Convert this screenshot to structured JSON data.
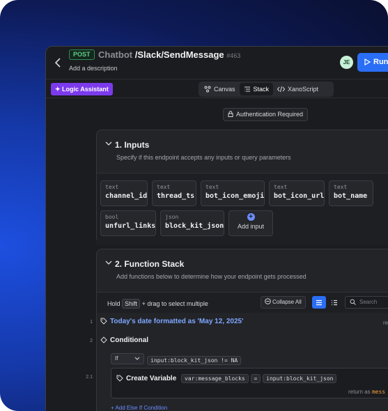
{
  "header": {
    "method": "POST",
    "crumb": "Chatbot",
    "path": "/Slack/SendMessage",
    "id": "#463",
    "description": "Add a description",
    "avatar": "JE",
    "run_label": "Run"
  },
  "toolbar": {
    "logic_assistant": "Logic Assistant",
    "tabs": [
      {
        "label": "Canvas",
        "icon": "canvas-icon"
      },
      {
        "label": "Stack",
        "icon": "stack-icon",
        "active": true
      },
      {
        "label": "XanoScript",
        "icon": "code-icon"
      }
    ]
  },
  "auth_chip": "Authentication Required",
  "inputs": {
    "title": "1. Inputs",
    "subtitle": "Specify if this endpoint accepts any inputs or query parameters",
    "items": [
      {
        "type": "text",
        "name": "channel_id"
      },
      {
        "type": "text",
        "name": "thread_ts"
      },
      {
        "type": "text",
        "name": "bot_icon_emoji"
      },
      {
        "type": "text",
        "name": "bot_icon_url"
      },
      {
        "type": "text",
        "name": "bot_name"
      },
      {
        "type": "bool",
        "name": "unfurl_links"
      },
      {
        "type": "json",
        "name": "block_kit_json"
      }
    ],
    "add_label": "Add input"
  },
  "stack": {
    "title": "2. Function Stack",
    "subtitle": "Add functions below to determine how your endpoint gets processed",
    "hold": "Hold",
    "shift": "Shift",
    "drag_hint": "+ drag to select multiple",
    "collapse_all": "Collapse All",
    "search_placeholder": "Search",
    "rows": [
      {
        "num": "1",
        "label": "Today's date formatted as 'May 12, 2025'",
        "trail": "re"
      },
      {
        "num": "2",
        "label": "Conditional"
      },
      {
        "num": "2.1",
        "label": "Create Variable"
      }
    ],
    "if_label": "If",
    "condition": "input:block_kit_json != NA",
    "var_name": "var:message_blocks",
    "equals": "=",
    "var_value": "input:block_kit_json",
    "return_as": "return as",
    "return_var": "mess",
    "add_else": "+ Add Else If Condition"
  },
  "colors": {
    "accent": "#2a6ef5",
    "logic": "#7c3aed",
    "post": "#5fd08a"
  }
}
